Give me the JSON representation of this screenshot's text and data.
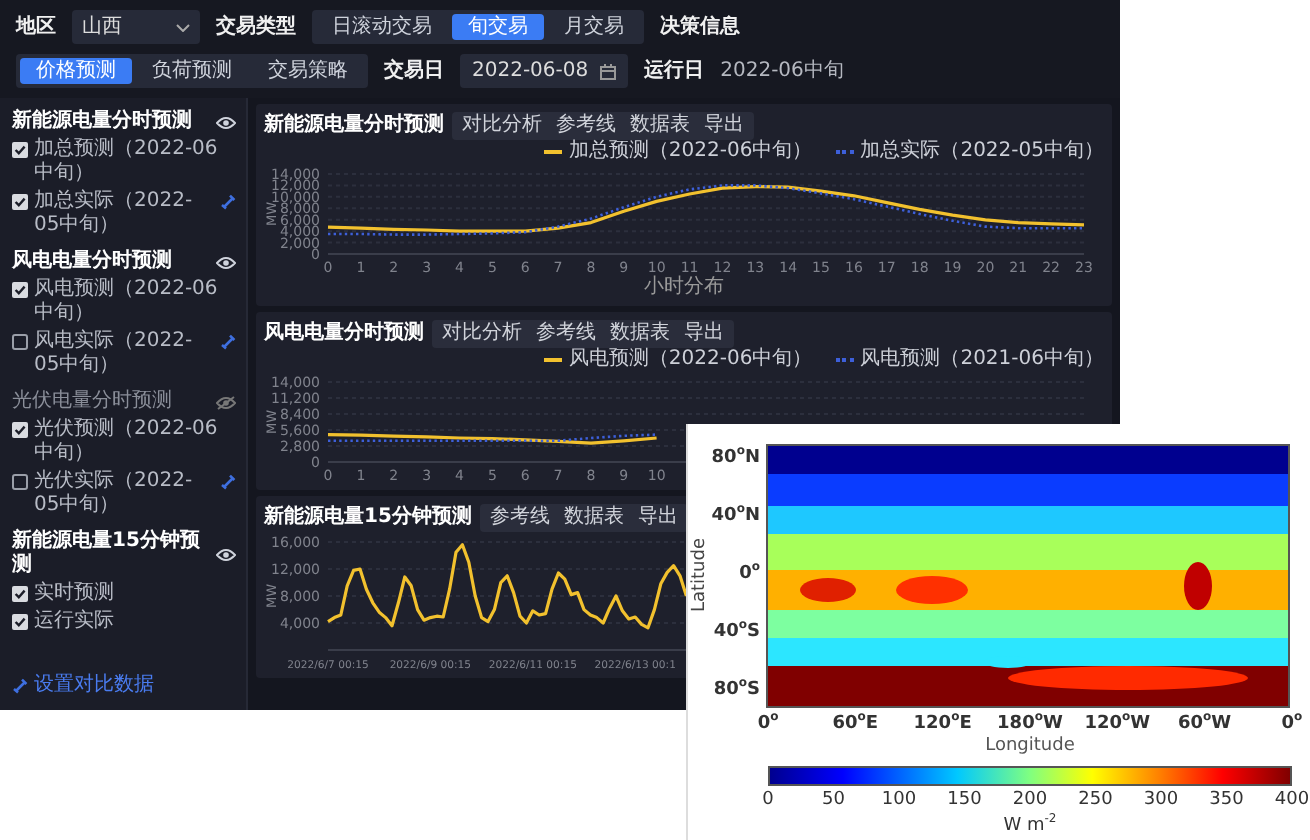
{
  "filters": {
    "region_label": "地区",
    "region": "山西",
    "trade_type_label": "交易类型",
    "trade_types": [
      {
        "label": "日滚动交易",
        "selected": false
      },
      {
        "label": "旬交易",
        "selected": true
      },
      {
        "label": "月交易",
        "selected": false
      }
    ],
    "decision_label": "决策信息",
    "decisions": [
      {
        "label": "价格预测",
        "selected": true
      },
      {
        "label": "负荷预测",
        "selected": false
      },
      {
        "label": "交易策略",
        "selected": false
      }
    ],
    "trade_date_label": "交易日",
    "trade_date": "2022-06-08",
    "run_date_label": "运行日",
    "run_date": "2022-06中旬"
  },
  "sidebar": {
    "sections": [
      {
        "title": "新能源电量分时预测",
        "visible": true,
        "items": [
          {
            "label": "加总预测（2022-06中旬）",
            "checked": true,
            "compare_link": false
          },
          {
            "label": "加总实际（2022-05中旬）",
            "checked": true,
            "compare_link": true
          }
        ]
      },
      {
        "title": "风电电量分时预测",
        "visible": true,
        "items": [
          {
            "label": "风电预测（2022-06中旬）",
            "checked": true,
            "compare_link": false
          },
          {
            "label": "风电实际（2022-05中旬）",
            "checked": false,
            "compare_link": true
          }
        ]
      },
      {
        "title": "光伏电量分时预测",
        "visible": false,
        "items": [
          {
            "label": "光伏预测（2022-06中旬）",
            "checked": true,
            "compare_link": false
          },
          {
            "label": "光伏实际（2022-05中旬）",
            "checked": false,
            "compare_link": true
          }
        ]
      },
      {
        "title": "新能源电量15分钟预测",
        "visible": true,
        "items": [
          {
            "label": "实时预测",
            "checked": true,
            "compare_link": false
          },
          {
            "label": "运行实际",
            "checked": true,
            "compare_link": false
          }
        ]
      }
    ],
    "footer_link": "设置对比数据"
  },
  "charts": [
    {
      "title": "新能源电量分时预测",
      "tools": [
        "对比分析",
        "参考线",
        "数据表",
        "导出"
      ],
      "chart_data": {
        "type": "line",
        "xlabel": "小时分布",
        "ylabel": "MW",
        "grid": true,
        "x": [
          0,
          1,
          2,
          3,
          4,
          5,
          6,
          7,
          8,
          9,
          10,
          11,
          12,
          13,
          14,
          15,
          16,
          17,
          18,
          19,
          20,
          21,
          22,
          23
        ],
        "xlim": [
          0,
          23
        ],
        "ylim": [
          0,
          14000
        ],
        "xticks": [
          0,
          1,
          2,
          3,
          4,
          5,
          6,
          7,
          8,
          9,
          10,
          11,
          12,
          13,
          14,
          15,
          16,
          17,
          18,
          19,
          20,
          21,
          22,
          23
        ],
        "yticks": [
          {
            "value": 0,
            "label": "0"
          },
          {
            "value": 2000,
            "label": "2,000"
          },
          {
            "value": 4000,
            "label": "4,000"
          },
          {
            "value": 6000,
            "label": "6,000"
          },
          {
            "value": 8000,
            "label": "8,000"
          },
          {
            "value": 10000,
            "label": "10,000"
          },
          {
            "value": 12000,
            "label": "12,000"
          },
          {
            "value": 14000,
            "label": "14,000"
          }
        ],
        "series": [
          {
            "name": "加总预测（2022-06中旬）",
            "color": "#f2c12e",
            "line_style": "solid",
            "values": [
              4700,
              4500,
              4300,
              4200,
              4000,
              4000,
              4000,
              4500,
              5500,
              7500,
              9200,
              10500,
              11500,
              11800,
              11700,
              11000,
              10200,
              9000,
              7800,
              6800,
              6000,
              5500,
              5300,
              5100
            ]
          },
          {
            "name": "加总实际（2022-05中旬）",
            "color": "#3d5fd9",
            "line_style": "dotted",
            "values": [
              3500,
              3500,
              3400,
              3400,
              3500,
              3600,
              3800,
              4800,
              6200,
              8200,
              10000,
              11300,
              12000,
              12000,
              11500,
              10600,
              9600,
              8300,
              7000,
              5800,
              4800,
              4500,
              4500,
              4500
            ]
          }
        ]
      }
    },
    {
      "title": "风电电量分时预测",
      "tools": [
        "对比分析",
        "参考线",
        "数据表",
        "导出"
      ],
      "chart_data": {
        "type": "line",
        "ylabel": "MW",
        "grid": true,
        "x": [
          0,
          1,
          2,
          3,
          4,
          5,
          6,
          7,
          8,
          9,
          10
        ],
        "xlim": [
          0,
          23
        ],
        "ylim": [
          0,
          14000
        ],
        "xticks": [
          0,
          1,
          2,
          3,
          4,
          5,
          6,
          7,
          8,
          9,
          10
        ],
        "yticks": [
          {
            "value": 0,
            "label": "0"
          },
          {
            "value": 2800,
            "label": "2,800"
          },
          {
            "value": 5600,
            "label": "5,600"
          },
          {
            "value": 8400,
            "label": "8,400"
          },
          {
            "value": 11200,
            "label": "11,200"
          },
          {
            "value": 14000,
            "label": "14,000"
          }
        ],
        "series": [
          {
            "name": "风电预测（2022-06中旬）",
            "color": "#f2c12e",
            "line_style": "solid",
            "values": [
              4800,
              4700,
              4500,
              4400,
              4200,
              4100,
              3900,
              3600,
              3300,
              3700,
              4200
            ]
          },
          {
            "name": "风电预测（2021-06中旬）",
            "color": "#3d5fd9",
            "line_style": "dotted",
            "values": [
              3700,
              3700,
              3700,
              3700,
              3700,
              3700,
              3700,
              3700,
              4200,
              4600,
              4800
            ]
          }
        ]
      }
    },
    {
      "title": "新能源电量15分钟预测",
      "tools": [
        "参考线",
        "数据表",
        "导出"
      ],
      "chart_data": {
        "type": "line",
        "ylabel": "MW",
        "grid": true,
        "categories": [
          "2022/6/7 00:15",
          null,
          null,
          null,
          null,
          null,
          null,
          null,
          null,
          null,
          null,
          null,
          null,
          null,
          null,
          null,
          "2022/6/9 00:15",
          null,
          null,
          null,
          null,
          null,
          null,
          null,
          null,
          null,
          null,
          null,
          null,
          null,
          null,
          null,
          "2022/6/11 00:15",
          null,
          null,
          null,
          null,
          null,
          null,
          null,
          null,
          null,
          null,
          null,
          null,
          null,
          null,
          null,
          "2022/6/13 00:1",
          null,
          null,
          null,
          null,
          null,
          null,
          null,
          null
        ],
        "ylim": [
          0,
          16000
        ],
        "yticks": [
          {
            "value": 4000,
            "label": "4,000"
          },
          {
            "value": 8000,
            "label": "8,000"
          },
          {
            "value": 12000,
            "label": "12,000"
          },
          {
            "value": 16000,
            "label": "16,000"
          }
        ],
        "series": [
          {
            "color": "#f2c12e",
            "line_style": "solid",
            "values": [
              4200,
              4800,
              5200,
              9500,
              11800,
              12000,
              9000,
              7000,
              5600,
              4800,
              3600,
              7000,
              10800,
              9500,
              6000,
              4400,
              4800,
              5000,
              4900,
              9000,
              14500,
              15600,
              13000,
              8000,
              4800,
              4200,
              6000,
              10000,
              11000,
              8500,
              5000,
              4000,
              5800,
              5200,
              5400,
              9000,
              11400,
              10500,
              8200,
              8500,
              6000,
              5200,
              4800,
              4000,
              6200,
              8000,
              5800,
              4600,
              4900,
              3800,
              3300,
              6000,
              9800,
              11500,
              12500,
              11000,
              8000
            ]
          }
        ]
      }
    }
  ],
  "map_figure": {
    "ylabel": "Latitude",
    "xlabel": "Longitude",
    "yticks": [
      "80$^{o}$N",
      "40$^{o}$N",
      "0$^{o}$",
      "40$^{o}$S",
      "80$^{o}$S"
    ],
    "xticks": [
      "0$^{o}$",
      "60$^{o}$E",
      "120$^{o}$E",
      "180$^{o}$W",
      "120$^{o}$W",
      "60$^{o}$W",
      "0$^{o}$"
    ],
    "colorbar": {
      "ticks": [
        "0",
        "50",
        "100",
        "150",
        "200",
        "250",
        "300",
        "350",
        "400"
      ],
      "label": "W m$^{-2}$"
    }
  }
}
